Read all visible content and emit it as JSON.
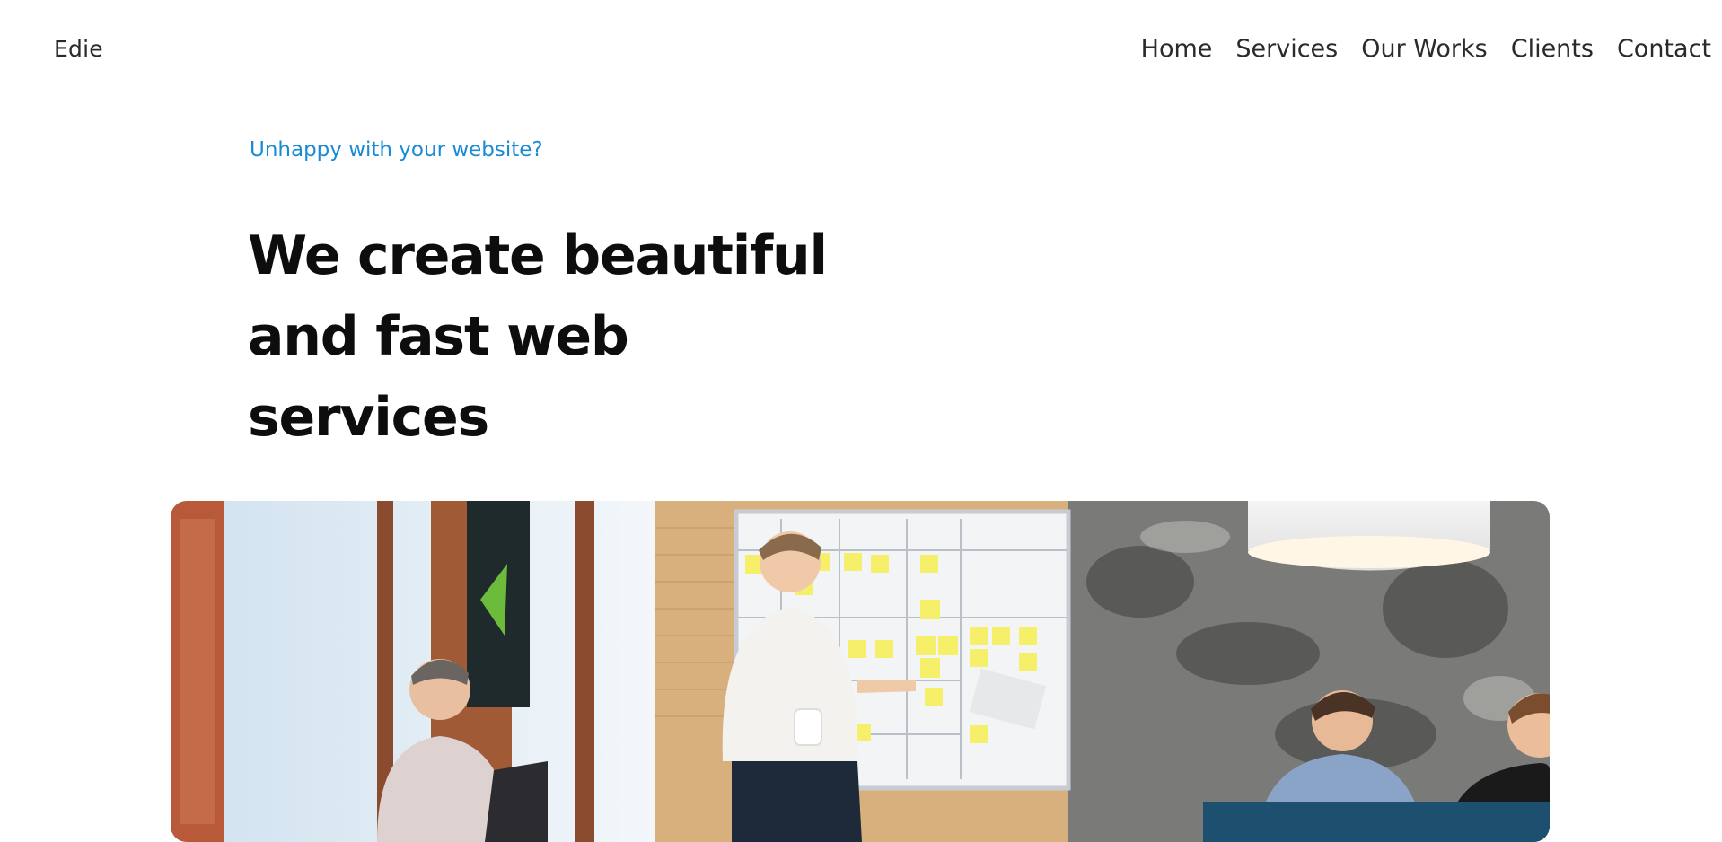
{
  "header": {
    "brand": "Edie",
    "nav": [
      {
        "label": "Home"
      },
      {
        "label": "Services"
      },
      {
        "label": "Our Works"
      },
      {
        "label": "Clients"
      },
      {
        "label": "Contact"
      }
    ]
  },
  "hero": {
    "kicker": "Unhappy with your website?",
    "title_lines": [
      "We create beautiful",
      "and fast web",
      "services"
    ]
  },
  "colors": {
    "accent": "#1a8ad4",
    "text": "#0d0d0d"
  }
}
